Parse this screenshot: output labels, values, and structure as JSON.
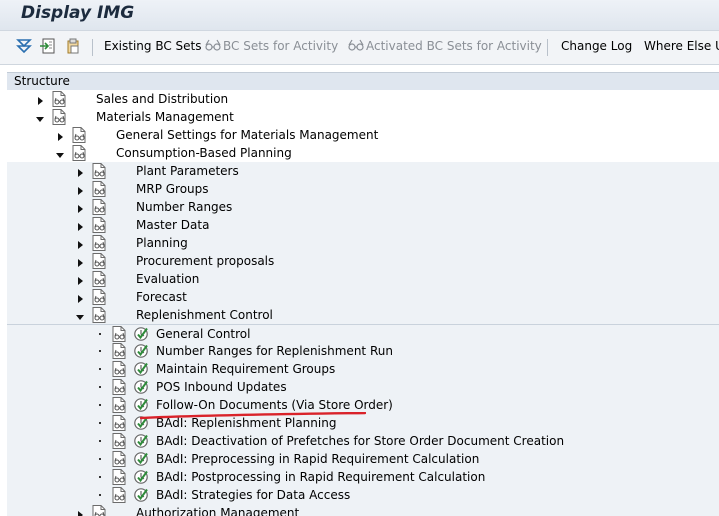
{
  "window": {
    "title": "Display IMG"
  },
  "toolbar": {
    "icons": [
      "expand-all-icon",
      "load-icon",
      "clipboard-icon"
    ],
    "buttons": [
      {
        "label": "Existing BC Sets",
        "enabled": true
      },
      {
        "label": "BC Sets for Activity",
        "enabled": false,
        "icon": "glasses-icon"
      },
      {
        "label": "Activated BC Sets for Activity",
        "enabled": false,
        "icon": "glasses-icon"
      },
      {
        "label": "Change Log",
        "enabled": true
      },
      {
        "label": "Where Else U",
        "enabled": true
      }
    ]
  },
  "tree": {
    "header": "Structure",
    "rows": [
      {
        "label": "Sales and Distribution",
        "level": 0,
        "state": "collapsed",
        "clock": false
      },
      {
        "label": "Materials Management",
        "level": 0,
        "state": "expanded",
        "clock": false
      },
      {
        "label": "General Settings for Materials Management",
        "level": 1,
        "state": "collapsed",
        "clock": false
      },
      {
        "label": "Consumption-Based Planning",
        "level": 1,
        "state": "expanded",
        "clock": false
      },
      {
        "label": "Plant Parameters",
        "level": 2,
        "state": "collapsed",
        "clock": false
      },
      {
        "label": "MRP Groups",
        "level": 2,
        "state": "collapsed",
        "clock": false
      },
      {
        "label": "Number Ranges",
        "level": 2,
        "state": "collapsed",
        "clock": false
      },
      {
        "label": "Master Data",
        "level": 2,
        "state": "collapsed",
        "clock": false
      },
      {
        "label": "Planning",
        "level": 2,
        "state": "collapsed",
        "clock": false
      },
      {
        "label": "Procurement proposals",
        "level": 2,
        "state": "collapsed",
        "clock": false
      },
      {
        "label": "Evaluation",
        "level": 2,
        "state": "collapsed",
        "clock": false
      },
      {
        "label": "Forecast",
        "level": 2,
        "state": "collapsed",
        "clock": false
      },
      {
        "label": "Replenishment Control",
        "level": 2,
        "state": "expanded",
        "clock": false
      },
      {
        "label": "General Control",
        "level": 3,
        "state": "leaf",
        "clock": true
      },
      {
        "label": "Number Ranges for Replenishment Run",
        "level": 3,
        "state": "leaf",
        "clock": true
      },
      {
        "label": "Maintain Requirement Groups",
        "level": 3,
        "state": "leaf",
        "clock": true
      },
      {
        "label": "POS Inbound Updates",
        "level": 3,
        "state": "leaf",
        "clock": true
      },
      {
        "label": "Follow-On Documents (Via Store Order)",
        "level": 3,
        "state": "leaf",
        "clock": true,
        "highlighted": true
      },
      {
        "label": "BAdI: Replenishment Planning",
        "level": 3,
        "state": "leaf",
        "clock": true
      },
      {
        "label": "BAdI: Deactivation of Prefetches for Store Order Document Creation",
        "level": 3,
        "state": "leaf",
        "clock": true
      },
      {
        "label": "BAdI: Preprocessing in Rapid Requirement Calculation",
        "level": 3,
        "state": "leaf",
        "clock": true
      },
      {
        "label": "BAdI: Postprocessing in Rapid Requirement Calculation",
        "level": 3,
        "state": "leaf",
        "clock": true
      },
      {
        "label": "BAdI: Strategies for Data Access",
        "level": 3,
        "state": "leaf",
        "clock": true
      },
      {
        "label": "Authorization Management",
        "level": 2,
        "state": "collapsed",
        "clock": false
      }
    ]
  },
  "colors": {
    "highlight_underline": "#d9222a",
    "clock_green": "#2e8b3a"
  }
}
